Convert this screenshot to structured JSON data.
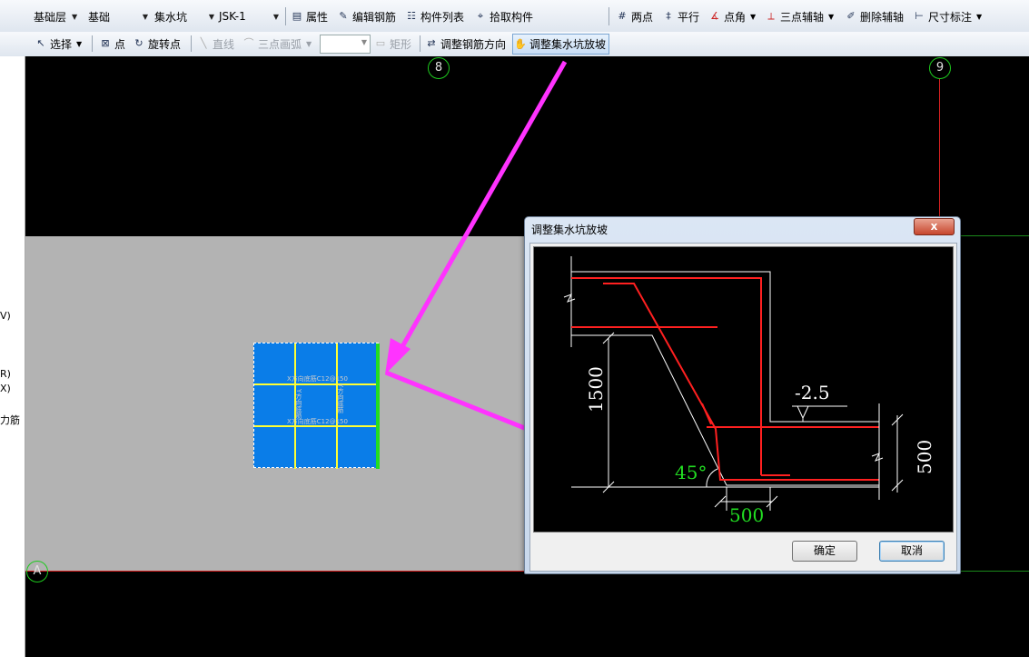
{
  "toolbar1": {
    "floor_combo": "基础层",
    "category_combo": "基础",
    "type_combo": "集水坑",
    "component_combo": "JSK-1",
    "properties": "属性",
    "edit_rebar": "编辑钢筋",
    "component_list": "构件列表",
    "pick_component": "拾取构件",
    "two_points": "两点",
    "parallel": "平行",
    "point_angle": "点角",
    "three_point_axis": "三点辅轴",
    "delete_axis": "删除辅轴",
    "dimension": "尺寸标注"
  },
  "toolbar2": {
    "select": "选择",
    "point": "点",
    "rotate_point": "旋转点",
    "line": "直线",
    "arc": "三点画弧",
    "rect": "矩形",
    "adjust_rebar_direction": "调整钢筋方向",
    "adjust_pit_slope": "调整集水坑放坡"
  },
  "left_panel": {
    "item_v": "V)",
    "item_r": "R)",
    "item_x": "X)",
    "item_rebar": "力筋"
  },
  "axes": {
    "axis_8": "8",
    "axis_9": "9",
    "axis_a": "A"
  },
  "pit": {
    "label_top": "X方向底筋C12@150",
    "label_bottom": "X方向底筋C12@150",
    "label_side1": "Y方向底筋",
    "label_side2": "Y方向底筋"
  },
  "dialog": {
    "title": "调整集水坑放坡",
    "close": "x",
    "depth_label": "1500",
    "elevation_label": "-2.5",
    "angle_label": "45°",
    "width_label": "500",
    "thickness_label": "500",
    "ok": "确定",
    "cancel": "取消"
  },
  "colors": {
    "accent_magenta": "#ff33ff",
    "pit_blue": "#0a7de8",
    "grid_yellow": "#ffff33",
    "rebar_red": "#ff2020",
    "dim_green": "#22dd22"
  }
}
